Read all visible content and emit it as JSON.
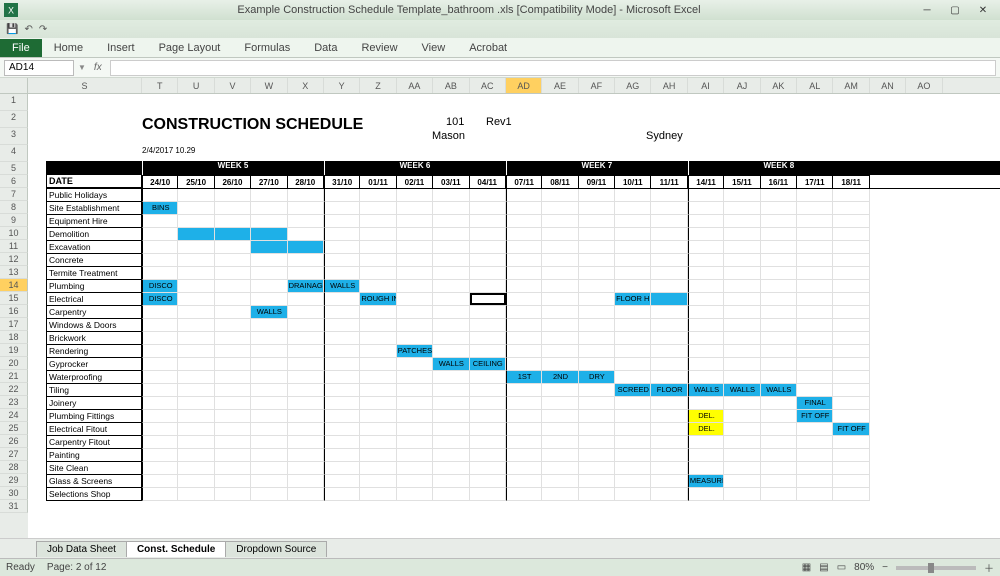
{
  "app": {
    "title": "Example Construction Schedule Template_bathroom .xls  [Compatibility Mode]  -  Microsoft Excel"
  },
  "ribbon": {
    "tabs": [
      "File",
      "Home",
      "Insert",
      "Page Layout",
      "Formulas",
      "Data",
      "Review",
      "View",
      "Acrobat"
    ]
  },
  "namebox": "AD14",
  "fx": "fx",
  "columns": [
    "T",
    "U",
    "V",
    "W",
    "X",
    "Y",
    "Z",
    "AA",
    "AB",
    "AC",
    "AD",
    "AE",
    "AF",
    "AG",
    "AH",
    "AI",
    "AJ",
    "AK",
    "AL",
    "AM",
    "AN",
    "AO"
  ],
  "active_col_index": 10,
  "task_col_excel": "S",
  "rows": [
    1,
    2,
    3,
    4,
    5,
    6,
    7,
    8,
    9,
    10,
    11,
    12,
    13,
    14,
    15,
    16,
    17,
    18,
    19,
    20,
    21,
    22,
    23,
    24,
    25,
    26,
    27,
    28,
    29,
    30,
    31
  ],
  "active_row_index": 13,
  "doc": {
    "title": "CONSTRUCTION SCHEDULE",
    "job_no": "101",
    "rev": "Rev1",
    "builder": "Mason",
    "location": "Sydney",
    "print_date": "2/4/2017 10.29"
  },
  "weeks": [
    "",
    "",
    "WEEK  5",
    "",
    "",
    "",
    "",
    "WEEK  6",
    "",
    "",
    "",
    "",
    "WEEK  7",
    "",
    "",
    "",
    "",
    "WEEK  8"
  ],
  "date_label": "DATE",
  "dates": [
    "24/10",
    "25/10",
    "26/10",
    "27/10",
    "28/10",
    "31/10",
    "01/11",
    "02/11",
    "03/11",
    "04/11",
    "07/11",
    "08/11",
    "09/11",
    "10/11",
    "11/11",
    "14/11",
    "15/11",
    "16/11",
    "17/11",
    "18/11"
  ],
  "tasks": [
    {
      "name": "Public Holidays",
      "cells": []
    },
    {
      "name": "Site Establishment",
      "cells": [
        {
          "i": 0,
          "t": "BINS",
          "c": "hl"
        }
      ]
    },
    {
      "name": "Equipment Hire",
      "cells": []
    },
    {
      "name": "Demolition",
      "cells": [
        {
          "i": 1,
          "c": "hl"
        },
        {
          "i": 2,
          "c": "hl"
        },
        {
          "i": 3,
          "c": "hl"
        }
      ]
    },
    {
      "name": "Excavation",
      "cells": [
        {
          "i": 3,
          "c": "hl"
        },
        {
          "i": 4,
          "c": "hl"
        }
      ]
    },
    {
      "name": "Concrete",
      "cells": []
    },
    {
      "name": "Termite Treatment",
      "cells": []
    },
    {
      "name": "Plumbing",
      "cells": [
        {
          "i": 0,
          "t": "DISCO",
          "c": "hl"
        },
        {
          "i": 4,
          "t": "DRAINAGE",
          "c": "hl"
        },
        {
          "i": 5,
          "t": "WALLS",
          "c": "hl"
        }
      ]
    },
    {
      "name": "Electrical",
      "cells": [
        {
          "i": 0,
          "t": "DISCO",
          "c": "hl"
        },
        {
          "i": 6,
          "t": "ROUGH IN",
          "c": "hl"
        },
        {
          "i": 13,
          "t": "FLOOR HEAT??",
          "c": "hl"
        },
        {
          "i": 14,
          "c": "hl"
        }
      ]
    },
    {
      "name": "Carpentry",
      "cells": [
        {
          "i": 3,
          "t": "WALLS",
          "c": "hl"
        }
      ]
    },
    {
      "name": "Windows & Doors",
      "cells": []
    },
    {
      "name": "Brickwork",
      "cells": []
    },
    {
      "name": "Rendering",
      "cells": [
        {
          "i": 7,
          "t": "PATCHES",
          "c": "hl"
        }
      ]
    },
    {
      "name": "Gyprocker",
      "cells": [
        {
          "i": 8,
          "t": "WALLS",
          "c": "hl"
        },
        {
          "i": 9,
          "t": "CEILING",
          "c": "hl"
        }
      ]
    },
    {
      "name": "Waterproofing",
      "cells": [
        {
          "i": 10,
          "t": "1ST",
          "c": "hl"
        },
        {
          "i": 11,
          "t": "2ND",
          "c": "hl"
        },
        {
          "i": 12,
          "t": "DRY",
          "c": "hl"
        }
      ]
    },
    {
      "name": "Tiling",
      "cells": [
        {
          "i": 13,
          "t": "SCREED",
          "c": "hl"
        },
        {
          "i": 14,
          "t": "FLOOR",
          "c": "hl"
        },
        {
          "i": 15,
          "t": "WALLS",
          "c": "hl"
        },
        {
          "i": 16,
          "t": "WALLS",
          "c": "hl"
        },
        {
          "i": 17,
          "t": "WALLS",
          "c": "hl"
        }
      ]
    },
    {
      "name": "Joinery",
      "cells": [
        {
          "i": 18,
          "t": "FINAL",
          "c": "hl"
        }
      ]
    },
    {
      "name": "Plumbing Fittings",
      "cells": [
        {
          "i": 15,
          "t": "DEL.",
          "c": "yl"
        },
        {
          "i": 18,
          "t": "FIT OFF",
          "c": "hl"
        }
      ]
    },
    {
      "name": "Electrical Fitout",
      "cells": [
        {
          "i": 15,
          "t": "DEL.",
          "c": "yl"
        },
        {
          "i": 19,
          "t": "FIT OFF",
          "c": "hl"
        }
      ]
    },
    {
      "name": "Carpentry Fitout",
      "cells": []
    },
    {
      "name": "Painting",
      "cells": []
    },
    {
      "name": "Site Clean",
      "cells": []
    },
    {
      "name": "Glass & Screens",
      "cells": [
        {
          "i": 15,
          "t": "MEASURE",
          "c": "hl"
        }
      ]
    },
    {
      "name": "Selections Shop",
      "cells": []
    }
  ],
  "sheet_tabs": [
    "Job Data Sheet",
    "Const. Schedule",
    "Dropdown Source"
  ],
  "active_sheet_tab": 1,
  "status": {
    "ready": "Ready",
    "page": "Page: 2 of 12",
    "zoom": "80%"
  }
}
